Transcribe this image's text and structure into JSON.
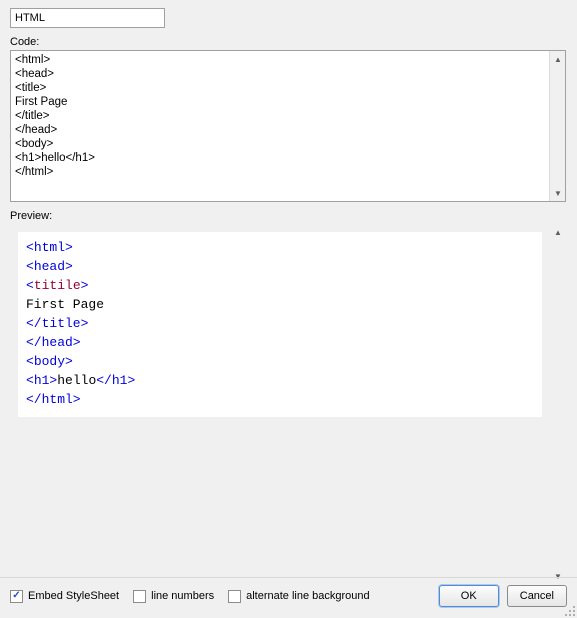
{
  "name_field": {
    "value": "HTML"
  },
  "labels": {
    "code": "Code:",
    "preview": "Preview:"
  },
  "code": {
    "text": "<html>\n<head>\n<title>\nFirst Page\n</title>\n</head>\n<body>\n<h1>hello</h1>\n</html>"
  },
  "preview_lines": [
    {
      "kind": "open",
      "tag": "html",
      "name_color": "blue"
    },
    {
      "kind": "open",
      "tag": "head",
      "name_color": "blue"
    },
    {
      "kind": "open",
      "tag": "titile",
      "name_color": "maroon"
    },
    {
      "kind": "text",
      "text": "First Page"
    },
    {
      "kind": "close",
      "tag": "title"
    },
    {
      "kind": "close",
      "tag": "head"
    },
    {
      "kind": "open",
      "tag": "body",
      "name_color": "blue"
    },
    {
      "kind": "wrap",
      "tag": "h1",
      "text": "hello"
    },
    {
      "kind": "close",
      "tag": "html"
    }
  ],
  "options": {
    "embed_stylesheet": {
      "label": "Embed StyleSheet",
      "checked": true
    },
    "line_numbers": {
      "label": "line numbers",
      "checked": false
    },
    "alt_bg": {
      "label": "alternate line background",
      "checked": false
    }
  },
  "buttons": {
    "ok": "OK",
    "cancel": "Cancel"
  }
}
